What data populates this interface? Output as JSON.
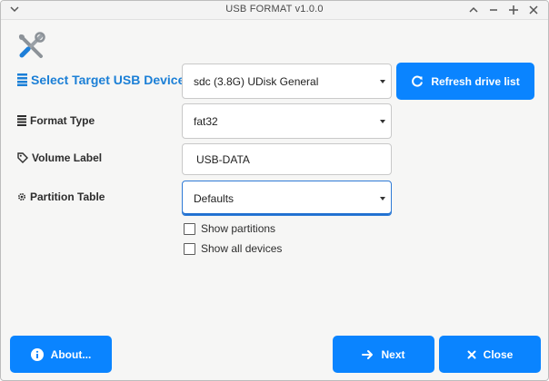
{
  "window": {
    "title": "USB FORMAT v1.0.0"
  },
  "rows": {
    "device": {
      "label": "Select Target USB Device",
      "value": "sdc (3.8G) UDisk General"
    },
    "format": {
      "label": "Format Type",
      "value": "fat32"
    },
    "volume": {
      "label": "Volume Label",
      "value": "USB-DATA"
    },
    "partition": {
      "label": "Partition Table",
      "value": "Defaults"
    }
  },
  "buttons": {
    "refresh": "Refresh drive list",
    "about": "About...",
    "next": "Next",
    "close": "Close"
  },
  "checkboxes": {
    "show_partitions": {
      "label": "Show partitions",
      "checked": false
    },
    "show_all_devices": {
      "label": "Show all devices",
      "checked": false
    }
  },
  "colors": {
    "accent": "#0a84ff",
    "label_accent": "#1b7fd6"
  }
}
